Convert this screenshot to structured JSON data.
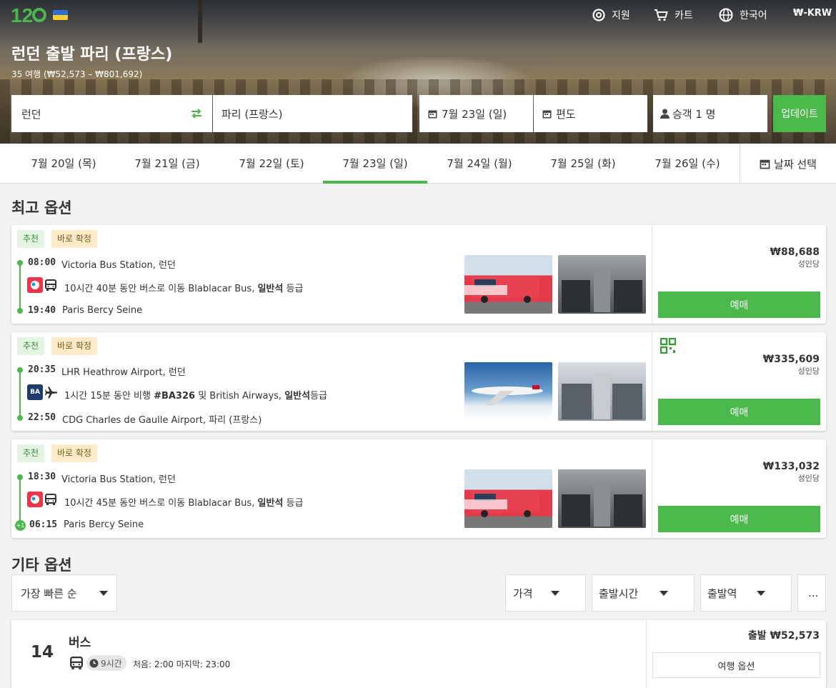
{
  "header": {
    "support": "지원",
    "cart": "카트",
    "language": "한국어",
    "currency": "₩-KRW"
  },
  "hero": {
    "title": "런던 출발 파리 (프랑스)",
    "subtitle": "35 여행 (₩52,573 – ₩801,692)"
  },
  "search": {
    "from": "런던",
    "to": "파리 (프랑스)",
    "date": "7월 23일 (일)",
    "return": "편도",
    "passengers": "승객 1 명",
    "update": "업데이트"
  },
  "dates": {
    "tabs": [
      "7월 20일 (목)",
      "7월 21일 (금)",
      "7월 22일 (토)",
      "7월 23일 (일)",
      "7월 24일 (월)",
      "7월 25일 (화)",
      "7월 26일 (수)"
    ],
    "active_index": 3,
    "picker": "날짜 선택"
  },
  "best": {
    "heading": "최고 옵션",
    "badge_rec": "추천",
    "badge_conf": "바로 확정",
    "per_adult": "성인당",
    "book": "예매",
    "options": [
      {
        "dep_time": "08:00",
        "dep_place": "Victoria Bus Station, 런던",
        "arr_time": "19:40",
        "arr_place": "Paris Bercy Seine",
        "detail_pre": "10시간 40분 동안 버스로 이동 Blablacar Bus, ",
        "detail_class": "일반석",
        "detail_post": " 등급",
        "price": "₩88,688",
        "mode": "bus"
      },
      {
        "dep_time": "20:35",
        "dep_place": "LHR Heathrow Airport, 런던",
        "arr_time": "22:50",
        "arr_place": "CDG Charles de Gaulle Airport, 파리 (프랑스)",
        "detail_pre": "1시간 15분 동안 비행 ",
        "detail_flight": "#BA326",
        "detail_mid": " 및 British Airways, ",
        "detail_class": "일반석",
        "detail_post": "등급",
        "price": "₩335,609",
        "mode": "flight",
        "operator_logo": "BA"
      },
      {
        "dep_time": "18:30",
        "dep_place": "Victoria Bus Station, 런던",
        "arr_time": "06:15",
        "arr_place": "Paris Bercy Seine",
        "next_day": "+1",
        "detail_pre": "10시간 45분 동안 버스로 이동 Blablacar Bus, ",
        "detail_class": "일반석",
        "detail_post": " 등급",
        "price": "₩133,032",
        "mode": "bus"
      }
    ]
  },
  "other": {
    "heading": "기타 옵션",
    "sort": "가장 빠른 순",
    "filters": [
      "가격",
      "출발시간",
      "출발역"
    ],
    "more": "...",
    "card": {
      "count": "14",
      "type": "버스",
      "duration": "9시간",
      "schedule": "처음: 2:00 마지막: 23:00",
      "price": "출발 ₩52,573",
      "options_button": "여행 옵션"
    }
  },
  "colors": {
    "accent": "#4bb84b",
    "badge_rec_bg": "#e3f4e3",
    "badge_conf_bg": "#fdebc8"
  }
}
